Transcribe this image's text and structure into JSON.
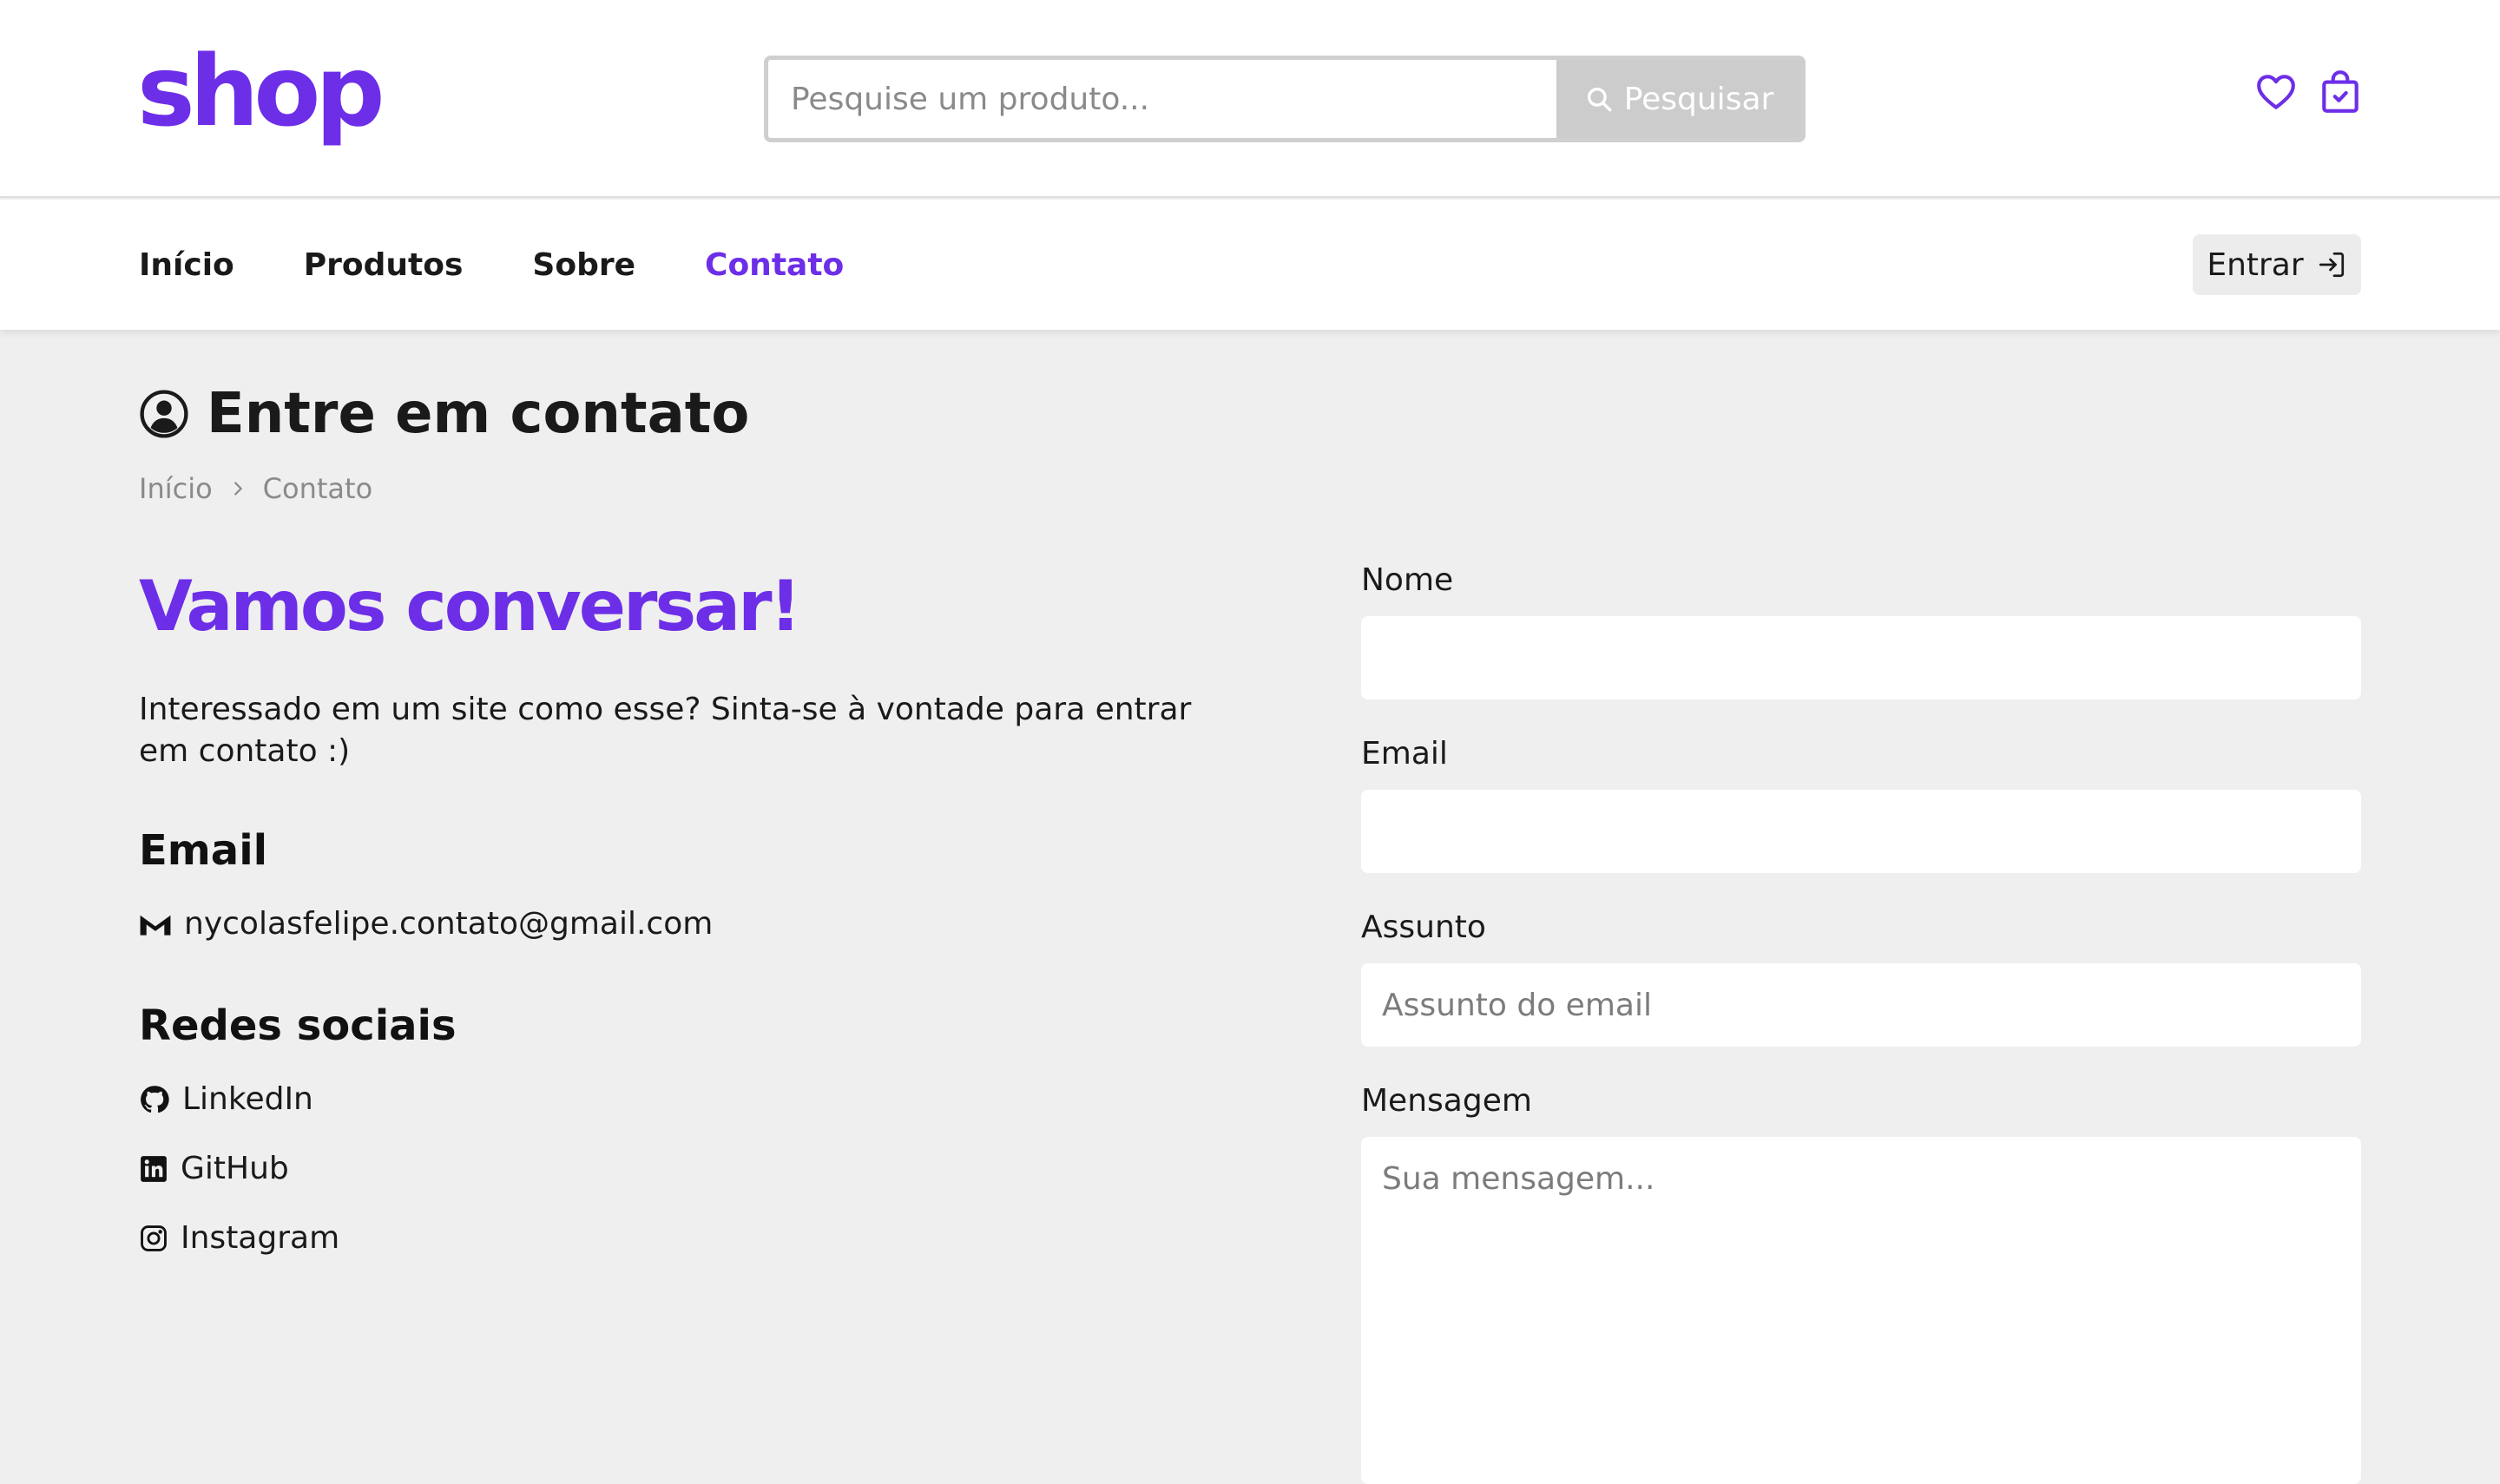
{
  "colors": {
    "brand": "#6d2ee8",
    "page_bg": "#efefef",
    "search_button": "#cccccc"
  },
  "header": {
    "logo": "shop",
    "search": {
      "placeholder": "Pesquise um produto...",
      "button_label": "Pesquisar",
      "icon": "search-icon"
    },
    "icons": [
      "heart-icon",
      "shopping-bag-icon"
    ]
  },
  "nav": {
    "items": [
      {
        "label": "Início",
        "active": false
      },
      {
        "label": "Produtos",
        "active": false
      },
      {
        "label": "Sobre",
        "active": false
      },
      {
        "label": "Contato",
        "active": true
      }
    ],
    "login_label": "Entrar"
  },
  "page": {
    "title": "Entre em contato",
    "title_icon": "user-circle-icon",
    "breadcrumb": [
      "Início",
      "Contato"
    ]
  },
  "left": {
    "headline": "Vamos conversar!",
    "intro": "Interessado em um site como esse? Sinta-se à vontade para entrar em contato :)",
    "email_heading": "Email",
    "email_address": "nycolasfelipe.contato@gmail.com",
    "social_heading": "Redes sociais",
    "socials": [
      {
        "label": "LinkedIn",
        "icon": "github-icon"
      },
      {
        "label": "GitHub",
        "icon": "linkedin-icon"
      },
      {
        "label": "Instagram",
        "icon": "instagram-icon"
      }
    ]
  },
  "form": {
    "name_label": "Nome",
    "name_value": "",
    "email_label": "Email",
    "email_value": "",
    "subject_label": "Assunto",
    "subject_placeholder": "Assunto do email",
    "message_label": "Mensagem",
    "message_placeholder": "Sua mensagem..."
  }
}
